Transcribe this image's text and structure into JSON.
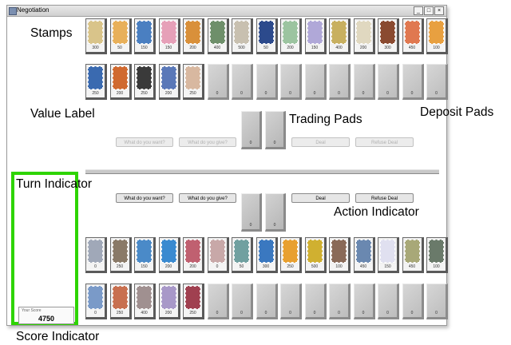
{
  "window": {
    "title": "Negotiation",
    "controls": [
      "_",
      "□",
      "×"
    ]
  },
  "callouts": {
    "stamps": "Stamps",
    "value_label": "Value Label",
    "trading_pads": "Trading Pads",
    "deposit_pads": "Deposit Pads",
    "turn_indicator": "Turn Indicator",
    "action_indicator": "Action Indicator",
    "score_indicator": "Score Indicator"
  },
  "opponent": {
    "stamps": [
      {
        "value": "300",
        "color": "#d9c48a"
      },
      {
        "value": "50",
        "color": "#e8b05a"
      },
      {
        "value": "150",
        "color": "#4a7fc1"
      },
      {
        "value": "150",
        "color": "#e6a0b8"
      },
      {
        "value": "200",
        "color": "#d9903a"
      },
      {
        "value": "400",
        "color": "#6e8f6a"
      },
      {
        "value": "500",
        "color": "#c8c0b0"
      },
      {
        "value": "50",
        "color": "#2c4a8c"
      },
      {
        "value": "200",
        "color": "#9cc4a0"
      },
      {
        "value": "150",
        "color": "#b0a8d8"
      },
      {
        "value": "400",
        "color": "#c8b060"
      },
      {
        "value": "200",
        "color": "#e0d8c0"
      },
      {
        "value": "300",
        "color": "#8a4a30"
      },
      {
        "value": "450",
        "color": "#e07850"
      },
      {
        "value": "100",
        "color": "#e8a040"
      }
    ],
    "stamps_row2": [
      {
        "value": "250",
        "color": "#3a6ab0"
      },
      {
        "value": "200",
        "color": "#d06a30"
      },
      {
        "value": "250",
        "color": "#3a3a3a"
      },
      {
        "value": "200",
        "color": "#5a78b8"
      },
      {
        "value": "250",
        "color": "#d8b8a0"
      }
    ],
    "deposit_values": [
      "0",
      "0",
      "0",
      "0",
      "0",
      "0",
      "0",
      "0",
      "0",
      "0"
    ],
    "trade_values": [
      "0",
      "0"
    ],
    "buttons": [
      "What do you want?",
      "What do you give?",
      "Deal",
      "Refuse Deal"
    ]
  },
  "player": {
    "trade_values": [
      "0",
      "0"
    ],
    "buttons": [
      "What do you want?",
      "What do you give?",
      "Deal",
      "Refuse Deal"
    ],
    "stamps": [
      {
        "value": "0",
        "color": "#a0a8b8"
      },
      {
        "value": "250",
        "color": "#8a7a68"
      },
      {
        "value": "150",
        "color": "#4a8ac8"
      },
      {
        "value": "200",
        "color": "#3a8ad0"
      },
      {
        "value": "200",
        "color": "#c06070"
      },
      {
        "value": "0",
        "color": "#c8a8a8"
      },
      {
        "value": "50",
        "color": "#70a0a0"
      },
      {
        "value": "300",
        "color": "#3a78c0"
      },
      {
        "value": "250",
        "color": "#e8a030"
      },
      {
        "value": "500",
        "color": "#d0b030"
      },
      {
        "value": "100",
        "color": "#8a6a58"
      },
      {
        "value": "450",
        "color": "#6a88b0"
      },
      {
        "value": "150",
        "color": "#e0e0f0"
      },
      {
        "value": "450",
        "color": "#a8a878"
      },
      {
        "value": "100",
        "color": "#6a7a6a"
      }
    ],
    "stamps_row2": [
      {
        "value": "0",
        "color": "#7a9ac8"
      },
      {
        "value": "250",
        "color": "#c87050"
      },
      {
        "value": "400",
        "color": "#a09090"
      },
      {
        "value": "200",
        "color": "#a898c8"
      },
      {
        "value": "250",
        "color": "#a04050"
      }
    ],
    "deposit_values": [
      "0",
      "0",
      "0",
      "0",
      "0",
      "0",
      "0",
      "0",
      "0",
      "0"
    ],
    "score_label": "Your Score",
    "score": "4750"
  }
}
